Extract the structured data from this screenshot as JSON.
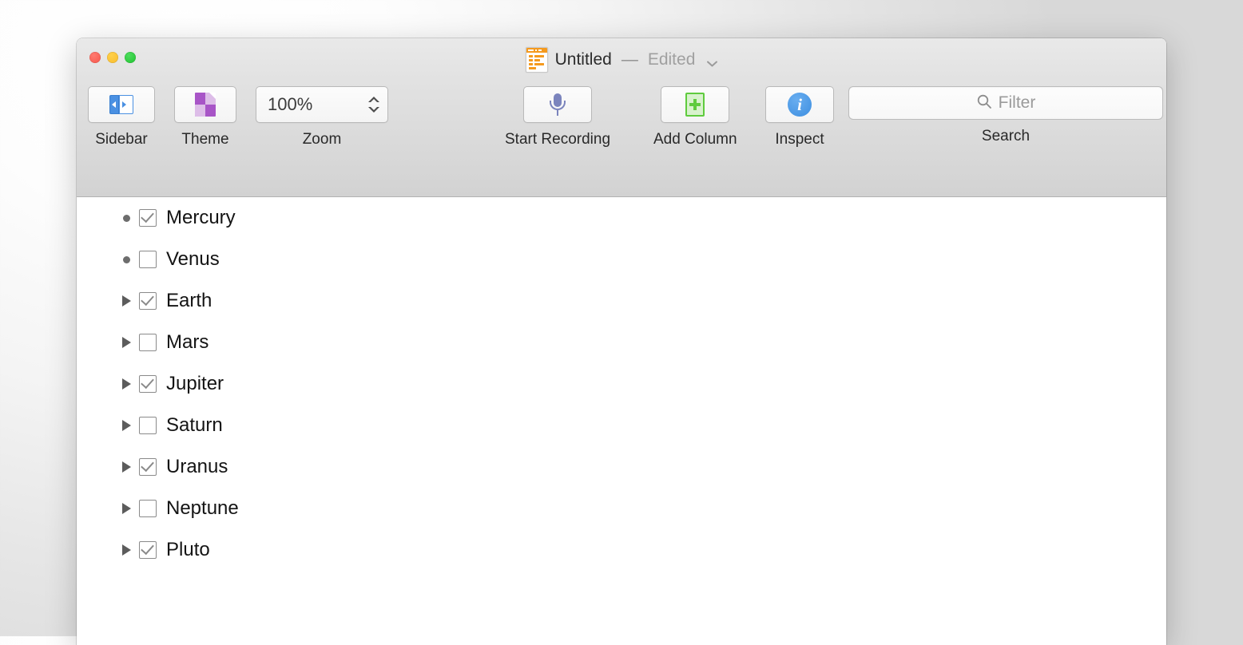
{
  "window": {
    "title_name": "Untitled",
    "title_separator": "—",
    "title_status": "Edited",
    "title_chevron_icon": "chevron-down-icon",
    "document_icon": "outline-document-icon",
    "traffic_lights": {
      "close_color": "#f6564b",
      "minimize_color": "#f8bc2e",
      "maximize_color": "#1fc22f"
    }
  },
  "toolbar": {
    "items": [
      {
        "label": "Sidebar",
        "icon": "sidebar-toggle-icon"
      },
      {
        "label": "Theme",
        "icon": "theme-page-icon"
      },
      {
        "label": "Zoom",
        "icon": "stepper-icon",
        "value": "100%"
      },
      {
        "label": "Start Recording",
        "icon": "microphone-icon"
      },
      {
        "label": "Add Column",
        "icon": "add-column-icon"
      },
      {
        "label": "Inspect",
        "icon": "info-circle-icon"
      },
      {
        "label": "Search",
        "icon": "search-icon",
        "placeholder": "Filter",
        "value": ""
      }
    ]
  },
  "outline": {
    "rows": [
      {
        "label": "Mercury",
        "marker": "bullet",
        "checked": true
      },
      {
        "label": "Venus",
        "marker": "bullet",
        "checked": false
      },
      {
        "label": "Earth",
        "marker": "arrow",
        "checked": true
      },
      {
        "label": "Mars",
        "marker": "arrow",
        "checked": false
      },
      {
        "label": "Jupiter",
        "marker": "arrow",
        "checked": true
      },
      {
        "label": "Saturn",
        "marker": "arrow",
        "checked": false
      },
      {
        "label": "Uranus",
        "marker": "arrow",
        "checked": true
      },
      {
        "label": "Neptune",
        "marker": "arrow",
        "checked": false
      },
      {
        "label": "Pluto",
        "marker": "arrow",
        "checked": true
      }
    ]
  },
  "colors": {
    "accent_blue": "#4a90e2",
    "theme_purple": "#a855c7",
    "add_column_green": "#5fcb3e",
    "doc_icon_orange": "#f59a1e",
    "mic_blue_gray": "#7b84bd"
  }
}
